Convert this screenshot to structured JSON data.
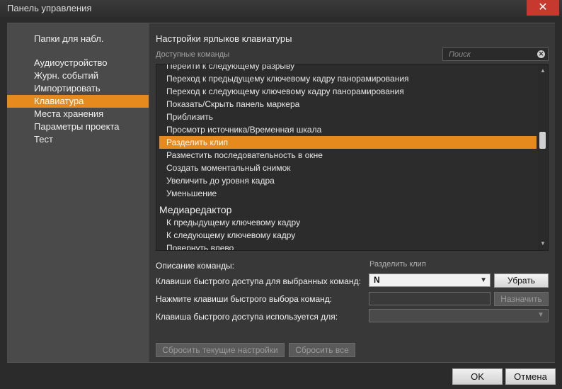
{
  "window": {
    "title": "Панель управления",
    "close_glyph": "✕"
  },
  "sidebar": {
    "header": "Папки для набл.",
    "items": [
      {
        "label": "Аудиоустройство"
      },
      {
        "label": "Журн. событий"
      },
      {
        "label": "Импортировать"
      },
      {
        "label": "Клавиатура"
      },
      {
        "label": "Места хранения"
      },
      {
        "label": "Параметры проекта"
      },
      {
        "label": "Тест"
      }
    ]
  },
  "main": {
    "title": "Настройки ярлыков клавиатуры",
    "available_label": "Доступные команды",
    "search": {
      "placeholder": "Поиск",
      "value": ""
    },
    "commands": [
      {
        "label": "Перейти к следующему разрыву"
      },
      {
        "label": "Переход к предыдущему ключевому кадру панорамирования"
      },
      {
        "label": "Переход к следующему ключевому кадру панорамирования"
      },
      {
        "label": "Показать/Скрыть панель маркера"
      },
      {
        "label": "Приблизить"
      },
      {
        "label": "Просмотр источника/Временная шкала"
      },
      {
        "label": "Разделить клип"
      },
      {
        "label": "Разместить последовательность в окне"
      },
      {
        "label": "Создать моментальный снимок"
      },
      {
        "label": "Увеличить до уровня кадра"
      },
      {
        "label": "Уменьшение"
      }
    ],
    "group_heading": "Медиаредактор",
    "group_commands": [
      {
        "label": "К предыдущему ключевому кадру"
      },
      {
        "label": "К следующему ключевому кадру"
      },
      {
        "label": "Повернуть влево"
      }
    ],
    "description_label": "Описание команды:",
    "description_value": "Разделить клип",
    "shortcut_label": "Клавиши быстрого доступа для выбранных команд:",
    "shortcut_value": "N",
    "remove_button": "Убрать",
    "press_label": "Нажмите клавиши быстрого выбора команд:",
    "press_value": "",
    "assign_button": "Назначить",
    "used_label": "Клавиша быстрого доступа используется для:",
    "reset_current_button": "Сбросить текущие настройки",
    "reset_all_button": "Сбросить все"
  },
  "footer": {
    "ok": "OK",
    "cancel": "Отмена"
  },
  "colors": {
    "accent": "#e78a1e",
    "close": "#c7392f"
  }
}
